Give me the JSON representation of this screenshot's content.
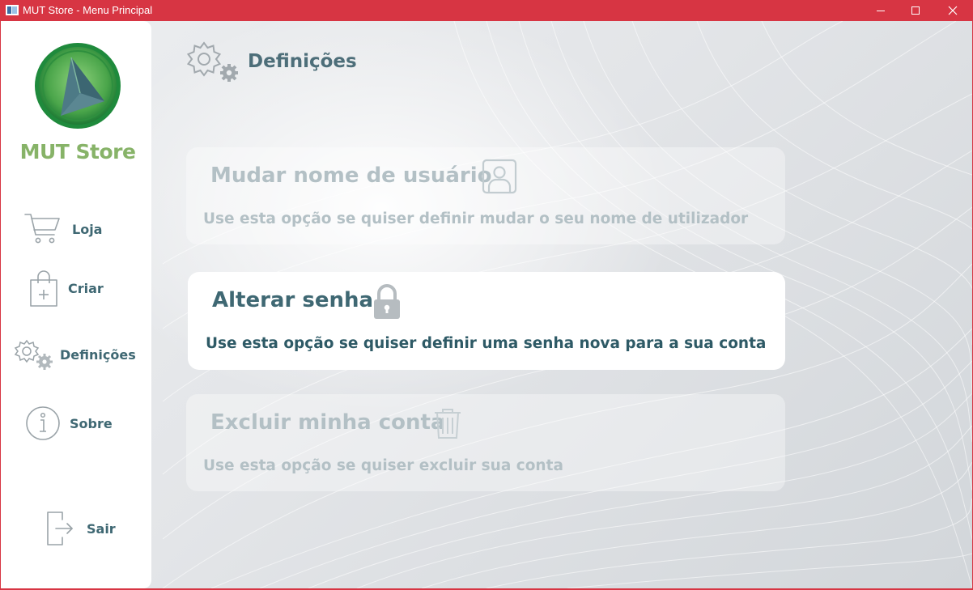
{
  "window": {
    "title": "MUT Store - Menu Principal"
  },
  "sidebar": {
    "brand": "MUT Store",
    "items": [
      {
        "label": "Loja",
        "icon": "cart-icon"
      },
      {
        "label": "Criar",
        "icon": "shopping-bag-add-icon"
      },
      {
        "label": "Definições",
        "icon": "gears-icon"
      },
      {
        "label": "Sobre",
        "icon": "info-icon"
      }
    ],
    "logout": {
      "label": "Sair",
      "icon": "logout-icon"
    }
  },
  "header": {
    "title": "Definições",
    "icon": "gears-icon"
  },
  "cards": [
    {
      "title": "Mudar nome de usuário",
      "description": "Use esta opção se quiser definir mudar o seu nome de utilizador",
      "icon": "user-portrait-icon",
      "state": "disabled"
    },
    {
      "title": "Alterar senha",
      "description": "Use esta opção se quiser definir uma senha nova para a sua conta",
      "icon": "lock-icon",
      "state": "active"
    },
    {
      "title": "Excluir minha conta",
      "description": "Use esta opção se quiser excluir sua conta",
      "icon": "trash-icon",
      "state": "disabled"
    }
  ],
  "colors": {
    "titlebar": "#d73543",
    "brand": "#87b368",
    "nav_text": "#3f6873",
    "disabled_text": "#b3c0c5"
  }
}
